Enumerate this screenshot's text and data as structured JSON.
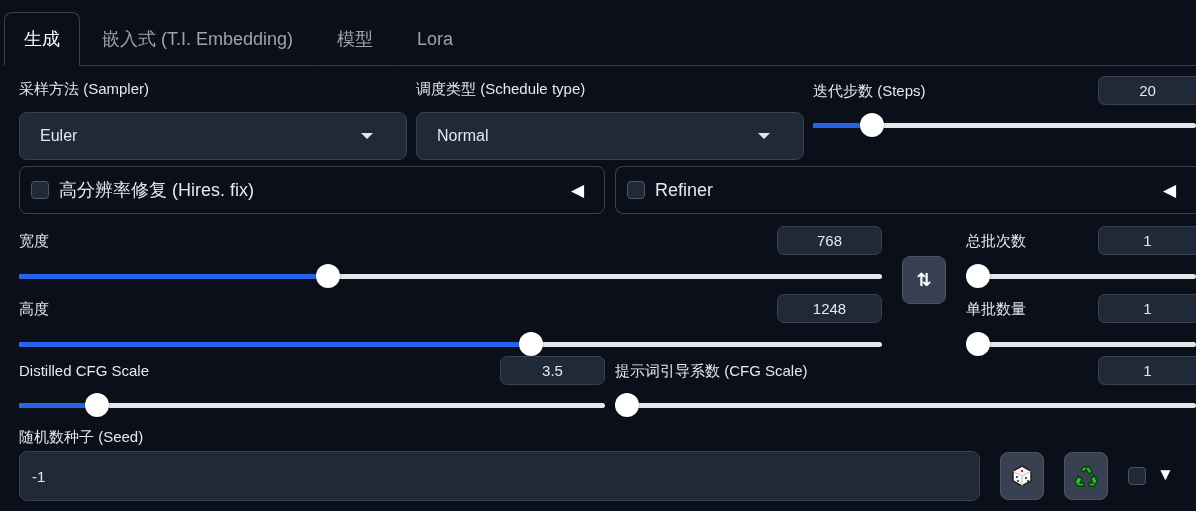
{
  "tabs": [
    {
      "label": "生成",
      "selected": true
    },
    {
      "label": "嵌入式 (T.I. Embedding)",
      "selected": false
    },
    {
      "label": "模型",
      "selected": false
    },
    {
      "label": "Lora",
      "selected": false
    }
  ],
  "sampler": {
    "label": "采样方法 (Sampler)",
    "value": "Euler"
  },
  "schedule_type": {
    "label": "调度类型 (Schedule type)",
    "value": "Normal"
  },
  "steps": {
    "label": "迭代步数 (Steps)",
    "value": "20",
    "level": 0.13
  },
  "accordions": [
    {
      "label": "高分辨率修复 (Hires. fix)",
      "checked": false,
      "arrow": "◀"
    },
    {
      "label": "Refiner",
      "checked": false,
      "arrow": "◀"
    }
  ],
  "width": {
    "label": "宽度",
    "value": "768",
    "level": 0.354
  },
  "height": {
    "label": "高度",
    "value": "1248",
    "level": 0.596
  },
  "swap_button": {
    "icon": "⇅"
  },
  "batch_count": {
    "label": "总批次数",
    "value": "1",
    "level": 0
  },
  "batch_size": {
    "label": "单批数量",
    "value": "1",
    "level": 0
  },
  "distilled_cfg": {
    "label": "Distilled CFG Scale",
    "value": "3.5",
    "level": 0.117
  },
  "cfg_scale": {
    "label": "提示词引导系数 (CFG Scale)",
    "value": "1",
    "level": 0
  },
  "seed": {
    "label": "随机数种子 (Seed)",
    "value": "-1",
    "extra_checked": false,
    "toggle": "▼"
  }
}
